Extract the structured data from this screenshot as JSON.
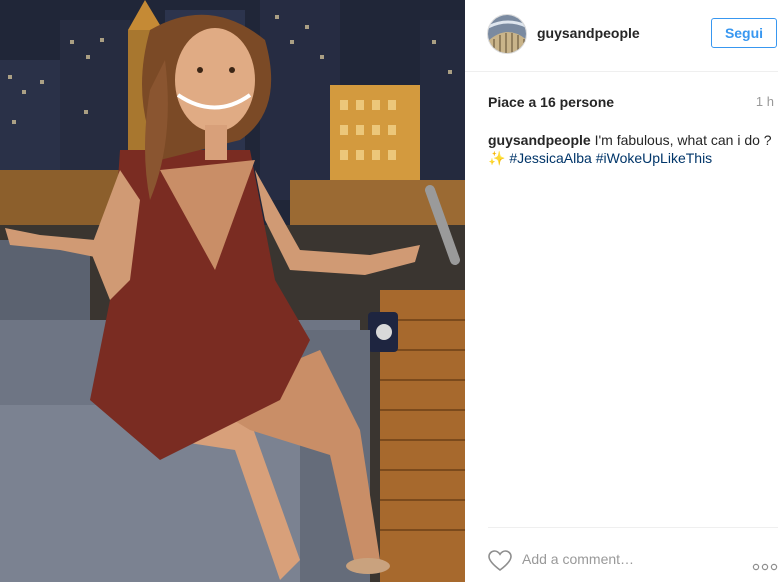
{
  "post": {
    "username": "guysandpeople",
    "follow_label": "Segui",
    "likes_text": "Piace a 16 persone",
    "time_ago": "1 h",
    "caption": {
      "user": "guysandpeople",
      "text": " I'm fabulous, what can i do ? ",
      "sparkle": "✨",
      "hashtags": [
        "#JessicaAlba",
        "#iWokeUpLikeThis"
      ]
    },
    "comment_placeholder": "Add a comment…"
  },
  "icons": {
    "like": "heart-icon",
    "options": "more-options-icon"
  },
  "colors": {
    "accent": "#3897f0",
    "hashtag": "#003569",
    "muted": "#999999"
  }
}
